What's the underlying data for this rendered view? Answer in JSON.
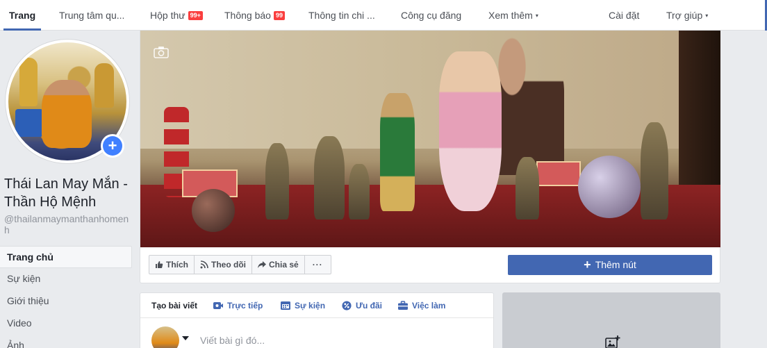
{
  "tabs": [
    {
      "label": "Trang",
      "active": true
    },
    {
      "label": "Trung tâm qu..."
    },
    {
      "label": "Hộp thư",
      "badge": "99+"
    },
    {
      "label": "Thông báo",
      "badge": "99"
    },
    {
      "label": "Thông tin chi ..."
    },
    {
      "label": "Công cụ đăng"
    },
    {
      "label": "Xem thêm",
      "caret": "▾"
    },
    {
      "label": "Cài đặt"
    },
    {
      "label": "Trợ giúp",
      "caret": "▾"
    }
  ],
  "page": {
    "name": "Thái Lan May Mắn - Thần Hộ Mệnh",
    "username": "@thailanmaymanthanhomenh"
  },
  "nav": [
    {
      "label": "Trang chủ",
      "active": true
    },
    {
      "label": "Sự kiện"
    },
    {
      "label": "Giới thiệu"
    },
    {
      "label": "Video"
    },
    {
      "label": "Ảnh"
    }
  ],
  "actions": {
    "like": "Thích",
    "follow": "Theo dõi",
    "share": "Chia sẻ",
    "more": "···",
    "add_button": "Thêm nút"
  },
  "composer": {
    "tabs": [
      "Tạo bài viết",
      "Trực tiếp",
      "Sự kiện",
      "Ưu đãi",
      "Việc làm"
    ],
    "placeholder": "Viết bài gì đó..."
  },
  "colors": {
    "accent": "#4267b2",
    "badge": "#fa3e3e",
    "link": "#4267b2"
  },
  "icons": [
    "camera-icon",
    "like-icon",
    "rss-icon",
    "share-arrow-icon",
    "video-icon",
    "calendar-icon",
    "percent-icon",
    "briefcase-icon",
    "add-photo-icon",
    "plus-icon"
  ]
}
